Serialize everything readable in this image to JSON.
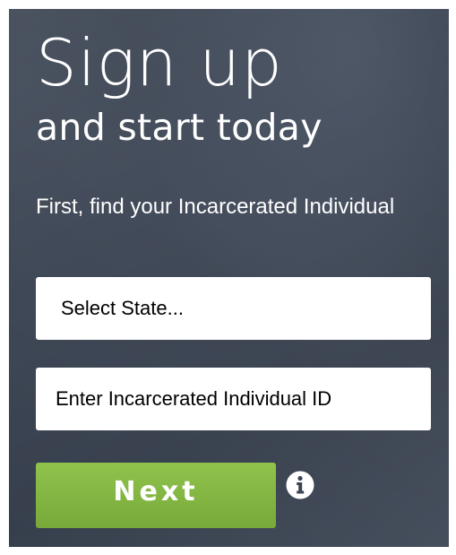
{
  "hero": {
    "title": "Sign up",
    "subtitle": "and start today"
  },
  "form": {
    "prompt": "First, find your Incarcerated Individual",
    "state_select": {
      "selected": "Select State..."
    },
    "id_input": {
      "placeholder": "Enter Incarcerated Individual ID",
      "value": ""
    },
    "next_label": "Next",
    "info_icon": "info-circle-icon"
  },
  "colors": {
    "panel_bg": "#3b4453",
    "button_green": "#84b743",
    "text_white": "#ffffff"
  }
}
